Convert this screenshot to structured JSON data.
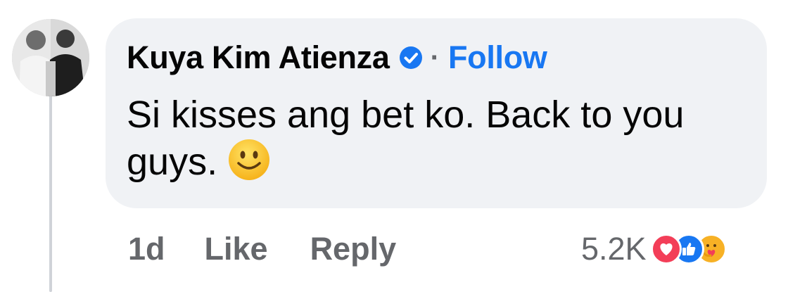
{
  "comment": {
    "author": "Kuya Kim Atienza",
    "separator": "·",
    "follow_label": "Follow",
    "text": "Si kisses ang bet ko. Back to you guys.",
    "emoji": "slightly-smiling-face-emoji"
  },
  "actions": {
    "time": "1d",
    "like_label": "Like",
    "reply_label": "Reply"
  },
  "reactions": {
    "count": "5.2K",
    "types": [
      "love-reaction-icon",
      "like-reaction-icon",
      "care-reaction-icon"
    ]
  },
  "colors": {
    "link_blue": "#1877f2",
    "bubble_bg": "#f0f2f5",
    "secondary_text": "#65676b"
  }
}
